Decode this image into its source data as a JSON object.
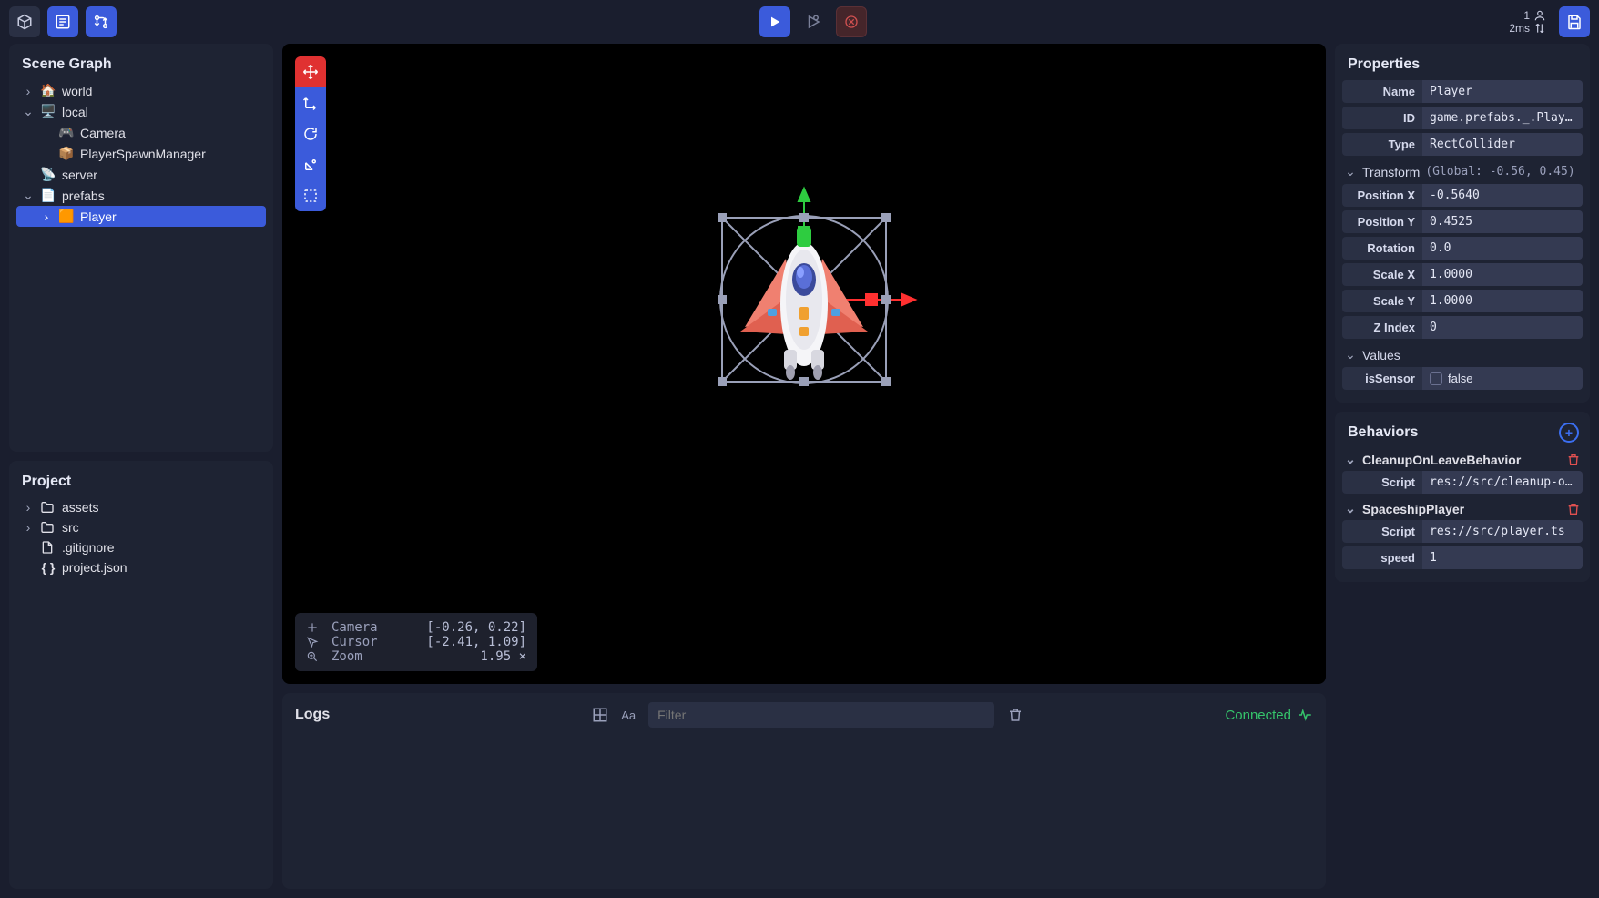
{
  "topbar": {
    "status_count": "1",
    "status_latency": "2ms"
  },
  "scene": {
    "title": "Scene Graph",
    "nodes": [
      {
        "label": "world",
        "icon": "🏠",
        "indent": 0,
        "chev": "right"
      },
      {
        "label": "local",
        "icon": "🖥️",
        "indent": 0,
        "chev": "down"
      },
      {
        "label": "Camera",
        "icon": "🎮",
        "indent": 1,
        "chev": ""
      },
      {
        "label": "PlayerSpawnManager",
        "icon": "📦",
        "indent": 1,
        "chev": ""
      },
      {
        "label": "server",
        "icon": "📡",
        "indent": 0,
        "chev": ""
      },
      {
        "label": "prefabs",
        "icon": "📄",
        "indent": 0,
        "chev": "down"
      },
      {
        "label": "Player",
        "icon": "🟧",
        "indent": 1,
        "chev": "right",
        "selected": true
      }
    ]
  },
  "project": {
    "title": "Project",
    "items": [
      {
        "label": "assets",
        "icon": "folder",
        "chev": "right"
      },
      {
        "label": "src",
        "icon": "folder",
        "chev": "right"
      },
      {
        "label": ".gitignore",
        "icon": "file",
        "chev": ""
      },
      {
        "label": "project.json",
        "icon": "braces",
        "chev": ""
      }
    ]
  },
  "hud": {
    "camera_label": "Camera",
    "camera_val": "[-0.26, 0.22]",
    "cursor_label": "Cursor",
    "cursor_val": "[-2.41, 1.09]",
    "zoom_label": "Zoom",
    "zoom_val": "1.95 ×"
  },
  "logs": {
    "title": "Logs",
    "filter_placeholder": "Filter",
    "connected": "Connected"
  },
  "properties": {
    "title": "Properties",
    "rows": [
      {
        "label": "Name",
        "value": "Player"
      },
      {
        "label": "ID",
        "value": "game.prefabs._.Player"
      },
      {
        "label": "Type",
        "value": "RectCollider"
      }
    ],
    "transform_title": "Transform",
    "transform_extra": "(Global: -0.56, 0.45)",
    "transform": [
      {
        "label": "Position X",
        "value": "-0.5640"
      },
      {
        "label": "Position Y",
        "value": "0.4525"
      },
      {
        "label": "Rotation",
        "value": "0.0"
      },
      {
        "label": "Scale X",
        "value": "1.0000"
      },
      {
        "label": "Scale Y",
        "value": "1.0000"
      },
      {
        "label": "Z Index",
        "value": "0"
      }
    ],
    "values_title": "Values",
    "values": [
      {
        "label": "isSensor",
        "value": "false",
        "checkbox": true
      }
    ]
  },
  "behaviors": {
    "title": "Behaviors",
    "items": [
      {
        "name": "CleanupOnLeaveBehavior",
        "rows": [
          {
            "label": "Script",
            "value": "res://src/cleanup-on…"
          }
        ]
      },
      {
        "name": "SpaceshipPlayer",
        "rows": [
          {
            "label": "Script",
            "value": "res://src/player.ts"
          },
          {
            "label": "speed",
            "value": "1"
          }
        ]
      }
    ]
  }
}
